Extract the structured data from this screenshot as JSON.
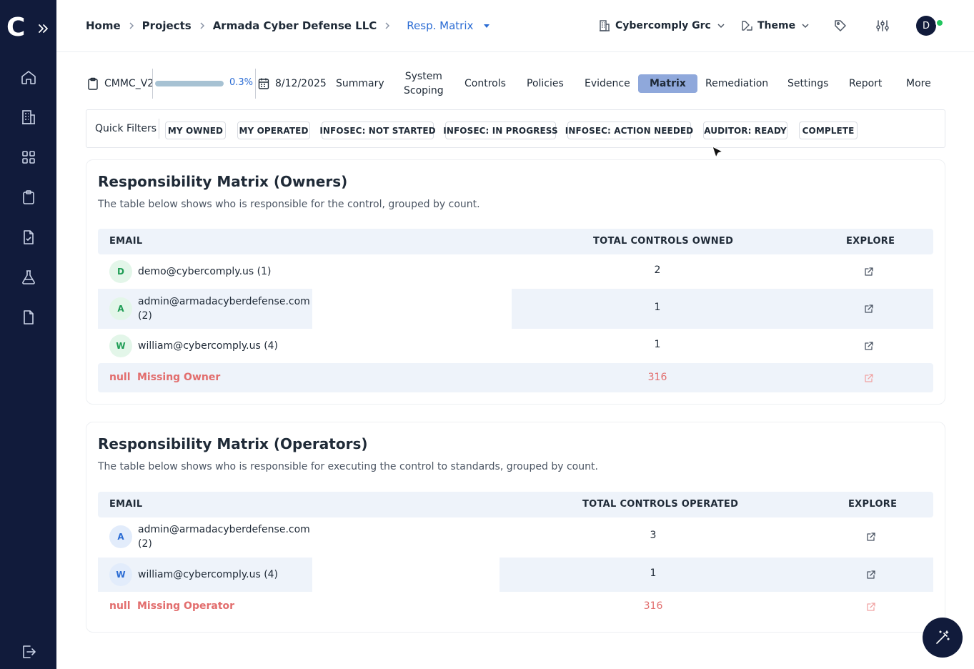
{
  "sidebar": {
    "logo_letter": "C",
    "items": [
      {
        "icon": "home-icon"
      },
      {
        "icon": "building-icon"
      },
      {
        "icon": "grid-icon"
      },
      {
        "icon": "clipboard-icon"
      },
      {
        "icon": "file-check-icon"
      },
      {
        "icon": "flask-icon"
      },
      {
        "icon": "document-icon"
      }
    ],
    "logout_icon": "logout-icon"
  },
  "header": {
    "breadcrumbs": [
      "Home",
      "Projects",
      "Armada Cyber Defense LLC"
    ],
    "active": "Resp. Matrix",
    "org_selector": "Cybercomply Grc",
    "theme_selector": "Theme",
    "avatar_initial": "D"
  },
  "framework": {
    "name": "CMMC_V2",
    "progress_percent": 0.3,
    "progress_label": "0.3%",
    "date": "8/12/2025"
  },
  "tabs": [
    {
      "label": "Summary"
    },
    {
      "label": "System\nScoping"
    },
    {
      "label": "Controls"
    },
    {
      "label": "Policies"
    },
    {
      "label": "Evidence"
    },
    {
      "label": "Matrix",
      "active": true
    },
    {
      "label": "Remediation"
    },
    {
      "label": "Settings"
    },
    {
      "label": "Report"
    },
    {
      "label": "More"
    }
  ],
  "quick_filters": {
    "label": "Quick Filters",
    "chips": [
      "MY OWNED",
      "MY OPERATED",
      "INFOSEC: NOT STARTED",
      "INFOSEC: IN PROGRESS",
      "INFOSEC: ACTION NEEDED",
      "AUDITOR: READY",
      "COMPLETE"
    ]
  },
  "owners": {
    "title": "Responsibility Matrix (Owners)",
    "description": "The table below shows who is responsible for the control, grouped by count.",
    "columns": [
      "EMAIL",
      "TOTAL CONTROLS OWNED",
      "EXPLORE"
    ],
    "rows": [
      {
        "initial": "D",
        "email_line1": "demo@cybercomply.us (1)",
        "email_line2": "",
        "count": "2"
      },
      {
        "initial": "A",
        "email_line1": "admin@armadacyberdefense.com",
        "email_line2": "(2)",
        "count": "1"
      },
      {
        "initial": "W",
        "email_line1": "william@cybercomply.us (4)",
        "email_line2": "",
        "count": "1"
      }
    ],
    "missing": {
      "null_label": "null",
      "label": "Missing Owner",
      "count": "316"
    }
  },
  "operators": {
    "title": "Responsibility Matrix (Operators)",
    "description": "The table below shows who is responsible for executing the control to standards, grouped by count.",
    "columns": [
      "EMAIL",
      "TOTAL CONTROLS OPERATED",
      "EXPLORE"
    ],
    "rows": [
      {
        "initial": "A",
        "email_line1": "admin@armadacyberdefense.com",
        "email_line2": "(2)",
        "count": "3"
      },
      {
        "initial": "W",
        "email_line1": "william@cybercomply.us (4)",
        "email_line2": "",
        "count": "1"
      }
    ],
    "missing": {
      "null_label": "null",
      "label": "Missing Operator",
      "count": "316"
    }
  },
  "colors": {
    "sidebar_bg": "#111b3b",
    "accent_blue": "#2b6cd4",
    "active_tab_bg": "#8fa8db",
    "missing_red": "#e26d6d",
    "stripe": "#eef3fa"
  }
}
